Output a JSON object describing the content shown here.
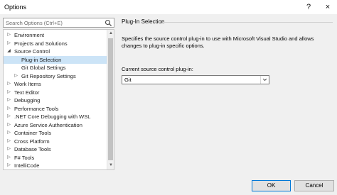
{
  "window": {
    "title": "Options",
    "help_glyph": "?",
    "close_glyph": "×"
  },
  "search": {
    "placeholder": "Search Options (Ctrl+E)",
    "icon": "search-icon"
  },
  "tree": {
    "items": [
      {
        "label": "Environment",
        "level": 0,
        "expander": "collapsed"
      },
      {
        "label": "Projects and Solutions",
        "level": 0,
        "expander": "collapsed"
      },
      {
        "label": "Source Control",
        "level": 0,
        "expander": "expanded"
      },
      {
        "label": "Plug-in Selection",
        "level": 1,
        "expander": "none",
        "selected": true
      },
      {
        "label": "Git Global Settings",
        "level": 1,
        "expander": "none"
      },
      {
        "label": "Git Repository Settings",
        "level": 1,
        "expander": "collapsed"
      },
      {
        "label": "Work Items",
        "level": 0,
        "expander": "collapsed"
      },
      {
        "label": "Text Editor",
        "level": 0,
        "expander": "collapsed"
      },
      {
        "label": "Debugging",
        "level": 0,
        "expander": "collapsed"
      },
      {
        "label": "Performance Tools",
        "level": 0,
        "expander": "collapsed"
      },
      {
        "label": ".NET Core Debugging with WSL",
        "level": 0,
        "expander": "collapsed"
      },
      {
        "label": "Azure Service Authentication",
        "level": 0,
        "expander": "collapsed"
      },
      {
        "label": "Container Tools",
        "level": 0,
        "expander": "collapsed"
      },
      {
        "label": "Cross Platform",
        "level": 0,
        "expander": "collapsed"
      },
      {
        "label": "Database Tools",
        "level": 0,
        "expander": "collapsed"
      },
      {
        "label": "F# Tools",
        "level": 0,
        "expander": "collapsed"
      },
      {
        "label": "IntelliCode",
        "level": 0,
        "expander": "collapsed"
      }
    ]
  },
  "panel": {
    "section_title": "Plug-In Selection",
    "description": "Specifies the source control plug-in to use with Microsoft Visual Studio and allows changes to plug-in specific options.",
    "field_label": "Current source control plug-in:",
    "field_value": "Git"
  },
  "buttons": {
    "ok": "OK",
    "cancel": "Cancel"
  },
  "colors": {
    "selection": "#cce4f7",
    "accent": "#0078d7"
  }
}
